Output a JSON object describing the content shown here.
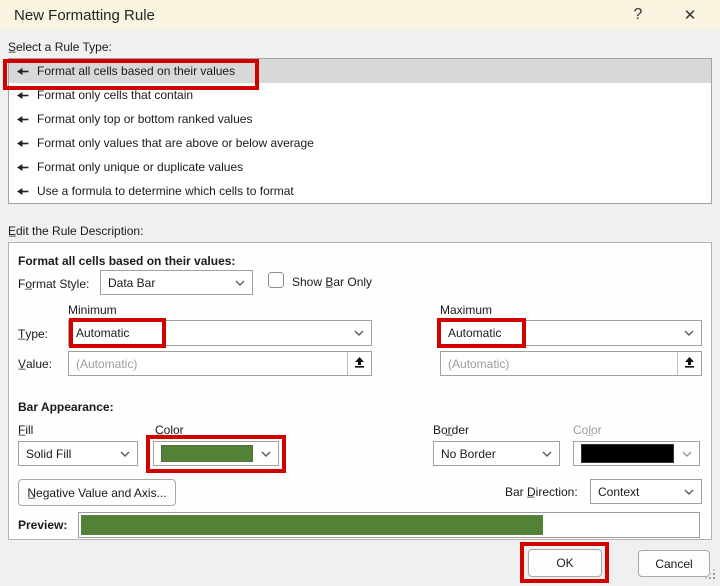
{
  "dialog": {
    "title": "New Formatting Rule",
    "help_icon": "?",
    "close_icon": "✕"
  },
  "icons": {
    "help": "question-mark",
    "close": "x-glyph",
    "list_bullet": "left-arrow",
    "combo": "chevron-down",
    "collapse": "arrow-up-from-bar",
    "resize": "diagonal-grip-dots"
  },
  "annotations": {
    "color": "#d30000"
  },
  "rule_type": {
    "label": "S̲elect a Rule Type:",
    "items": [
      {
        "label": "Format all cells based on their values",
        "selected": true
      },
      {
        "label": "Format only cells that contain",
        "selected": false
      },
      {
        "label": "Format only top or bottom ranked values",
        "selected": false
      },
      {
        "label": "Format only values that are above or below average",
        "selected": false
      },
      {
        "label": "Format only unique or duplicate values",
        "selected": false
      },
      {
        "label": "Use a formula to determine which cells to format",
        "selected": false
      }
    ]
  },
  "rule_description": {
    "section_label": "E̲dit the Rule Description:",
    "header": "Format all cells based on their values:",
    "format_style_label": "Fo̲rmat Style:",
    "format_style_value": "Data Bar",
    "show_bar_only_label": "Show B̲ar Only",
    "show_bar_only_checked": false,
    "type_label": "T̲ype:",
    "value_label": "V̲alue:",
    "minimum": {
      "header": "Minimum",
      "type_value": "Automatic",
      "value_placeholder": "(Automatic)"
    },
    "maximum": {
      "header": "Maximum",
      "type_value": "Automatic",
      "value_placeholder": "(Automatic)"
    }
  },
  "bar_appearance": {
    "header": "Bar Appearance:",
    "fill_label": "F̲ill",
    "fill_value": "Solid Fill",
    "color_label": "C̲olor",
    "color_swatch": "#538135",
    "border_label": "Bor̲der",
    "border_value": "No Border",
    "border_color_label": "Col̲or",
    "border_color_swatch": "#000000",
    "negative_button_label": "N̲egative Value and Axis...",
    "bar_direction_label": "Bar D̲irection:",
    "bar_direction_value": "Context",
    "preview_label": "Preview:",
    "preview_fill_percent": "75%",
    "preview_bar_color": "#538135"
  },
  "footer": {
    "ok_label": "OK",
    "cancel_label": "Cancel"
  }
}
